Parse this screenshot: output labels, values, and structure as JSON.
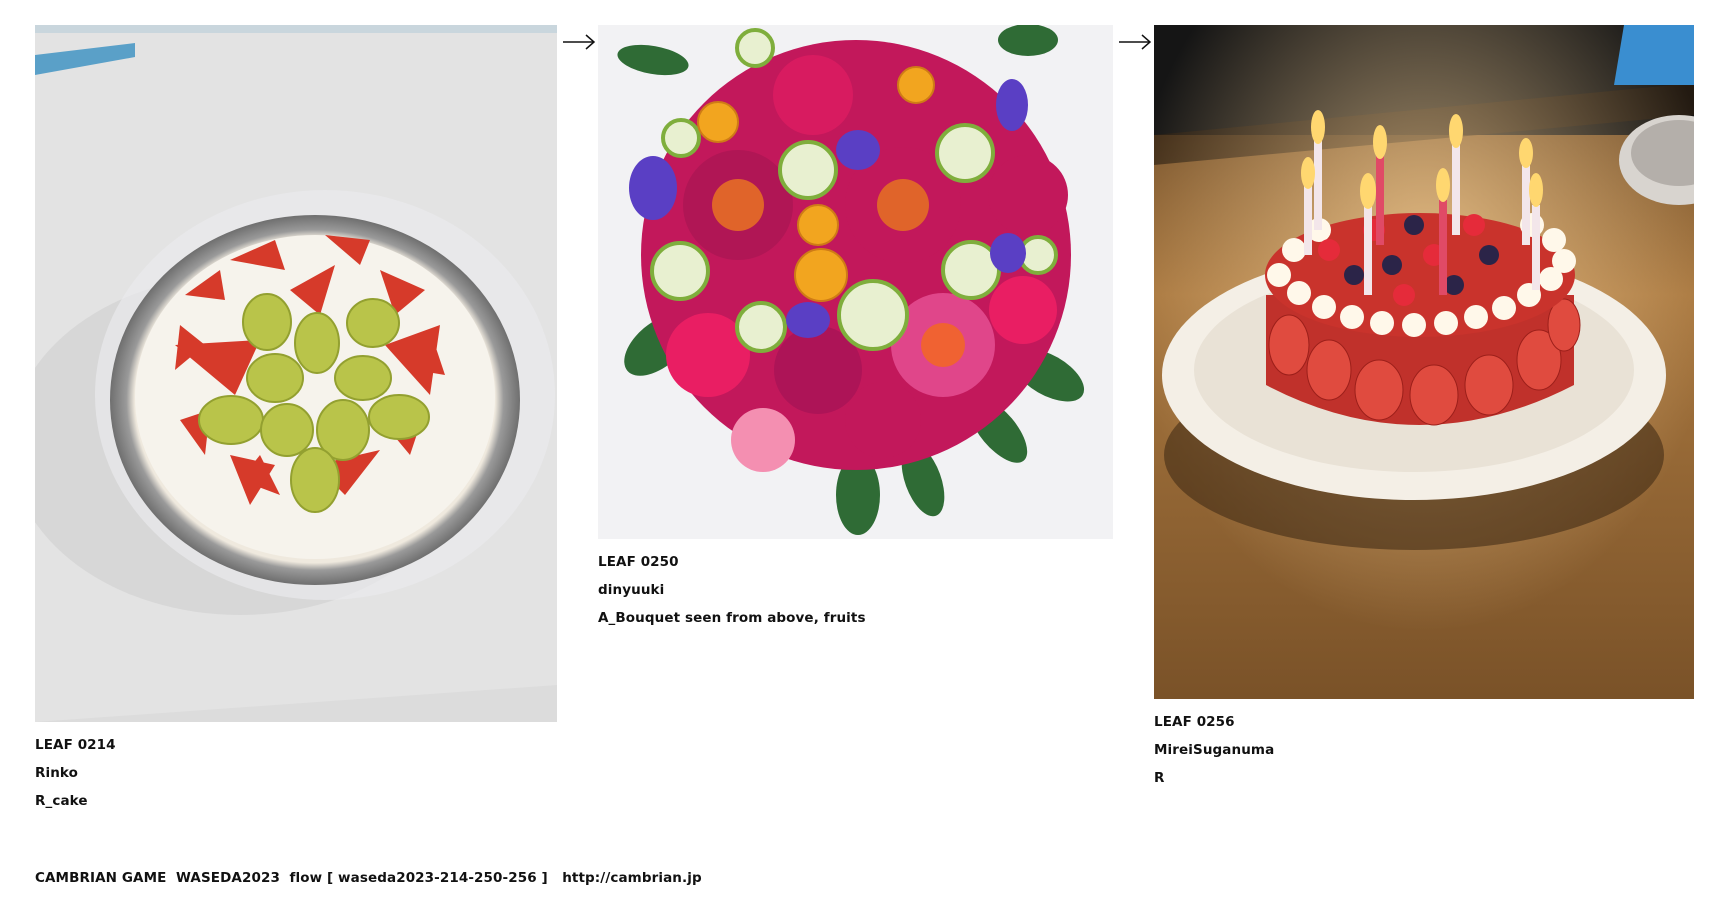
{
  "leaves": [
    {
      "number": "LEAF 0214",
      "author": "Rinko",
      "title": "R_cake",
      "image": "photo-cake-with-strawberries-and-grapes"
    },
    {
      "number": "LEAF 0250",
      "author": "dinyuuki",
      "title": "A_Bouquet seen from above, fruits",
      "image": "generated-bouquet-of-flowers-and-fruits"
    },
    {
      "number": "LEAF 0256",
      "author": "MireiSuganuma",
      "title": "R",
      "image": "photo-strawberry-cake-with-candles"
    }
  ],
  "arrows": [
    "arrow-right-icon",
    "arrow-right-icon"
  ],
  "footer": {
    "text": "CAMBRIAN GAME  WASEDA2023  flow [ waseda2023-214-250-256 ]   ",
    "link": "http://cambrian.jp"
  }
}
